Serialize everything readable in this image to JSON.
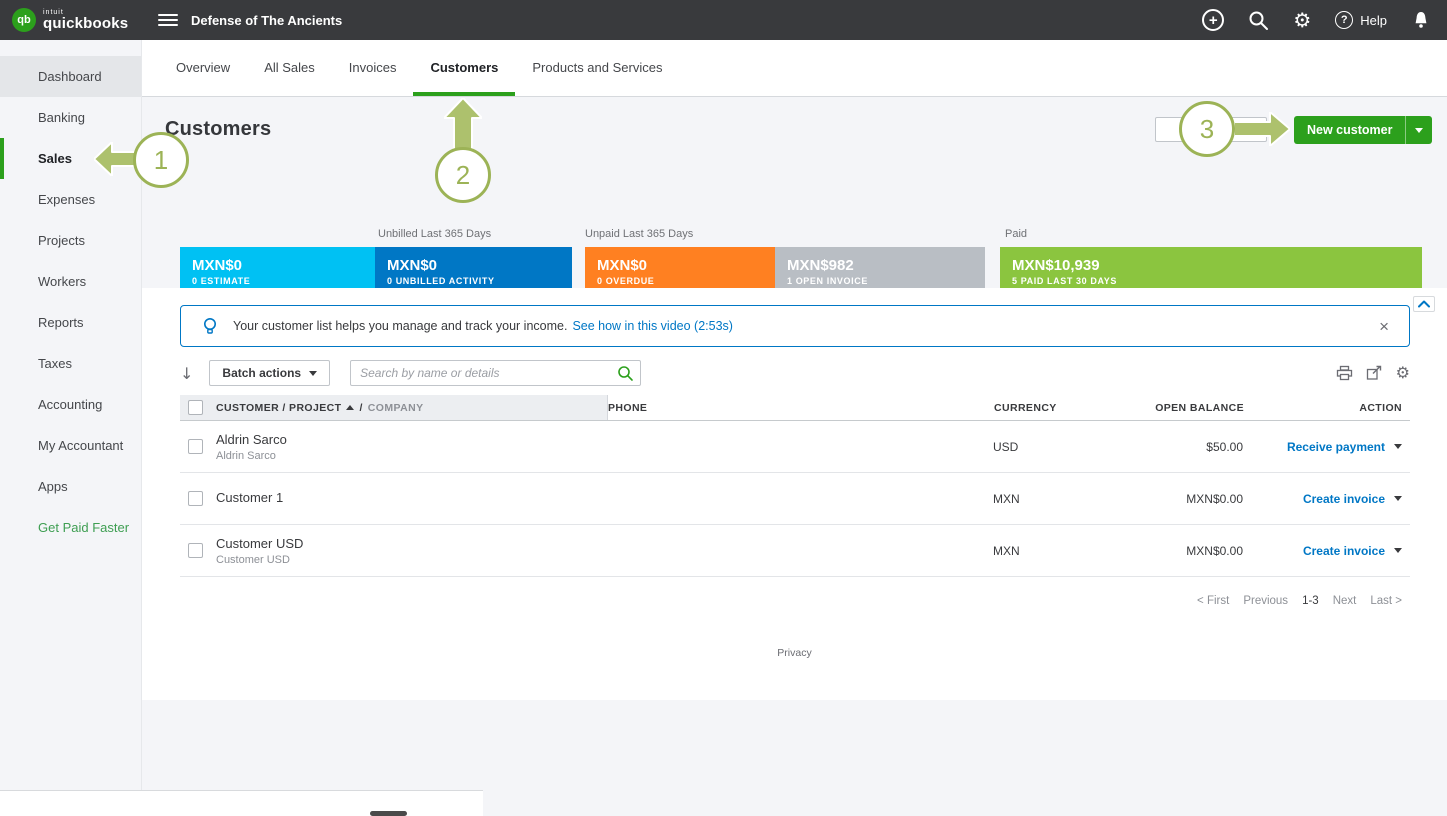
{
  "colors": {
    "brand_green": "#2ca01c",
    "link_blue": "#0077c5",
    "topbar_bg": "#393a3d",
    "page_bg": "#f4f5f8",
    "seg_estimate": "#00c1f3",
    "seg_unbilled": "#0077c5",
    "seg_overdue": "#ff8021",
    "seg_open": "#b9bec4",
    "seg_paid": "#8bc53f",
    "annotation_olive": "#9cb356",
    "annotation_fill": "#adc16d"
  },
  "icons": {
    "gear": "⚙",
    "close": "×",
    "sort": "↓",
    "plus": "+",
    "question": "?"
  },
  "topbar": {
    "brand_top": "intuit",
    "brand_bottom": "quickbooks",
    "company_name": "Defense of The Ancients",
    "help_label": "Help"
  },
  "sidebar": {
    "items": [
      {
        "label": "Dashboard"
      },
      {
        "label": "Banking"
      },
      {
        "label": "Sales"
      },
      {
        "label": "Expenses"
      },
      {
        "label": "Projects"
      },
      {
        "label": "Workers"
      },
      {
        "label": "Reports"
      },
      {
        "label": "Taxes"
      },
      {
        "label": "Accounting"
      },
      {
        "label": "My Accountant"
      },
      {
        "label": "Apps"
      },
      {
        "label": "Get Paid Faster"
      }
    ]
  },
  "tabs": {
    "items": [
      {
        "label": "Overview"
      },
      {
        "label": "All Sales"
      },
      {
        "label": "Invoices"
      },
      {
        "label": "Customers"
      },
      {
        "label": "Products and Services"
      }
    ]
  },
  "page": {
    "title": "Customers",
    "new_customer_label": "New customer"
  },
  "money_bar": {
    "labels": {
      "unbilled": "Unbilled Last 365 Days",
      "unpaid": "Unpaid Last 365 Days",
      "paid": "Paid"
    },
    "segments": [
      {
        "amount": "MXN$0",
        "caption": "0 ESTIMATE"
      },
      {
        "amount": "MXN$0",
        "caption": "0 UNBILLED ACTIVITY"
      },
      {
        "amount": "MXN$0",
        "caption": "0 OVERDUE"
      },
      {
        "amount": "MXN$982",
        "caption": "1 OPEN INVOICE"
      },
      {
        "amount": "MXN$10,939",
        "caption": "5 PAID LAST 30 DAYS"
      }
    ]
  },
  "banner": {
    "text": "Your customer list helps you manage and track your income.",
    "link": "See how in this video (2:53s)"
  },
  "toolbar": {
    "batch_actions_label": "Batch actions",
    "search_placeholder": "Search by name or details"
  },
  "table": {
    "headers": {
      "customer": "CUSTOMER / PROJECT",
      "sep": "/",
      "company": "COMPANY",
      "phone": "PHONE",
      "currency": "CURRENCY",
      "open_balance": "OPEN BALANCE",
      "action": "ACTION"
    },
    "rows": [
      {
        "name": "Aldrin Sarco",
        "company": "Aldrin Sarco",
        "phone": "",
        "currency": "USD",
        "open_balance": "$50.00",
        "action": "Receive payment"
      },
      {
        "name": "Customer 1",
        "company": "",
        "phone": "",
        "currency": "MXN",
        "open_balance": "MXN$0.00",
        "action": "Create invoice"
      },
      {
        "name": "Customer USD",
        "company": "Customer USD",
        "phone": "",
        "currency": "MXN",
        "open_balance": "MXN$0.00",
        "action": "Create invoice"
      }
    ]
  },
  "pagination": {
    "first": "< First",
    "previous": "Previous",
    "range": "1-3",
    "next": "Next",
    "last": "Last >"
  },
  "footer": {
    "privacy_label": "Privacy"
  },
  "annotations": {
    "one": "1",
    "two": "2",
    "three": "3"
  }
}
